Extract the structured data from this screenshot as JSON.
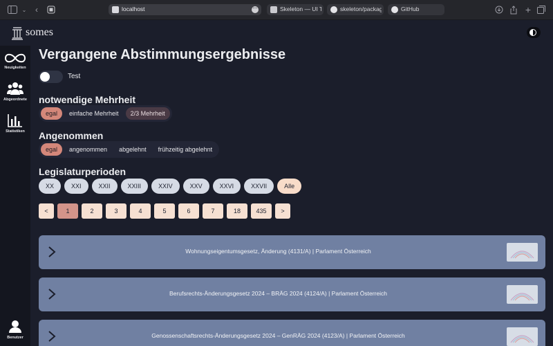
{
  "browser": {
    "url": "localhost",
    "tabs": [
      {
        "label": "Skeleton — UI T..."
      },
      {
        "label": "skeleton/packag..."
      },
      {
        "label": "GitHub"
      }
    ]
  },
  "app": {
    "brand": "somes"
  },
  "sidebar": {
    "items": [
      {
        "label": "Neuigkeiten",
        "icon": "infinity-icon"
      },
      {
        "label": "Abgeordnete",
        "icon": "people-icon"
      },
      {
        "label": "Statistiken",
        "icon": "bar-chart-icon"
      }
    ],
    "user": {
      "label": "Benutzer",
      "icon": "user-icon"
    }
  },
  "page": {
    "title": "Vergangene Abstimmungsergebnisse",
    "toggle_label": "Test",
    "mehrheit": {
      "heading": "notwendige Mehrheit",
      "options": [
        "egal",
        "einfache Mehrheit",
        "2/3 Mehrheit"
      ],
      "selected": "egal"
    },
    "angenommen": {
      "heading": "Angenommen",
      "options": [
        "egal",
        "angenommen",
        "abgelehnt",
        "frühzeitig abgelehnt"
      ],
      "selected": "egal"
    },
    "legislatur": {
      "heading": "Legislaturperioden",
      "options": [
        "XX",
        "XXI",
        "XXII",
        "XXIII",
        "XXIV",
        "XXV",
        "XXVI",
        "XXVII",
        "Alle"
      ]
    },
    "pagination": {
      "prev": "<",
      "next": ">",
      "pages": [
        "1",
        "2",
        "3",
        "4",
        "5",
        "6",
        "7",
        "18",
        "435"
      ],
      "current": "1"
    },
    "results": [
      {
        "title": "Wohnungseigentumsgesetz, Änderung (4131/A) | Parlament Österreich"
      },
      {
        "title": "Berufsrechts-Änderungsgesetz 2024 – BRÄG 2024 (4124/A) | Parlament Österreich"
      },
      {
        "title": "Genossenschaftsrechts-Änderungsgesetz 2024 – GenRÄG 2024 (4123/A) | Parlament Österreich"
      }
    ]
  },
  "colors": {
    "background": "#1b1e2b",
    "sidebar": "#14161f",
    "accent_selected": "#d4877a",
    "card": "#7080a2",
    "pill": "#d6dbe5",
    "alle_pill": "#f8dcc9"
  }
}
